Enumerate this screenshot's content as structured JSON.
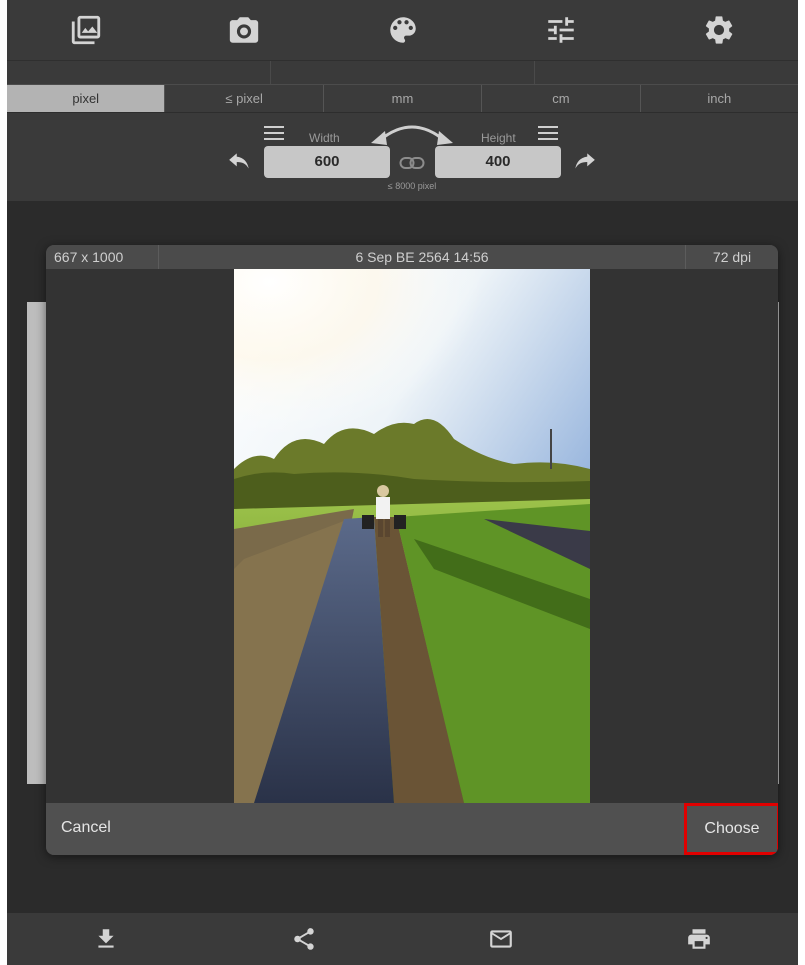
{
  "toolbar": {
    "icons": [
      "photo-library-icon",
      "camera-icon",
      "palette-icon",
      "sliders-icon",
      "gear-icon"
    ]
  },
  "units": {
    "tabs": [
      "pixel",
      "≤ pixel",
      "mm",
      "cm",
      "inch"
    ],
    "active": "pixel"
  },
  "size": {
    "width_label": "Width",
    "height_label": "Height",
    "width_value": "600",
    "height_value": "400",
    "limit_text": "≤ 8000 pixel"
  },
  "modal": {
    "dimensions": "667 x 1000",
    "date": "6 Sep BE 2564 14:56",
    "dpi": "72 dpi",
    "cancel_label": "Cancel",
    "choose_label": "Choose",
    "highlight_color": "#e00000"
  },
  "bottombar": {
    "icons": [
      "download-icon",
      "share-icon",
      "mail-icon",
      "print-icon"
    ]
  }
}
